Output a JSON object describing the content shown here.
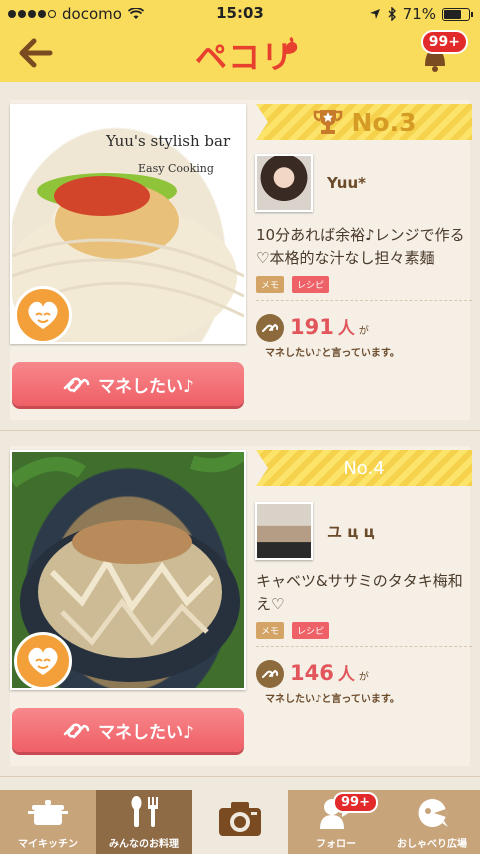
{
  "status": {
    "carrier": "docomo",
    "time": "15:03",
    "battery": "71%",
    "battery_level": 0.71
  },
  "header": {
    "logo": "ペコリ",
    "notification_count": "99+"
  },
  "feed": [
    {
      "rank": "No.3",
      "photo_text_line1": "Yuu's stylish bar",
      "photo_text_line2": "Easy Cooking",
      "username": "Yuu*",
      "description": "10分あれば余裕♪レンジで作る♡本格的な汁なし担々素麺",
      "tags": [
        "メモ",
        "レシピ"
      ],
      "count": "191",
      "count_unit": "人",
      "count_suffix": "が",
      "says": "マネしたい♪と言っています。",
      "button_label": "マネしたい♪"
    },
    {
      "rank": "No.4",
      "username": "ユ ц ц",
      "description": "キャベツ&ササミのタタキ梅和え♡",
      "tags": [
        "メモ",
        "レシピ"
      ],
      "count": "146",
      "count_unit": "人",
      "count_suffix": "が",
      "says": "マネしたい♪と言っています。",
      "button_label": "マネしたい♪"
    }
  ],
  "tabbar": {
    "items": [
      {
        "label": "マイキッチン",
        "icon": "pot-icon"
      },
      {
        "label": "みんなのお料理",
        "icon": "utensils-icon"
      },
      {
        "label": "",
        "icon": "camera-icon"
      },
      {
        "label": "フォロー",
        "icon": "follow-icon",
        "badge": "99+"
      },
      {
        "label": "おしゃべり広場",
        "icon": "chat-icon"
      }
    ]
  },
  "colors": {
    "header": "#f9dc5c",
    "accent": "#e2555a",
    "tabbar": "#c8a47b"
  }
}
